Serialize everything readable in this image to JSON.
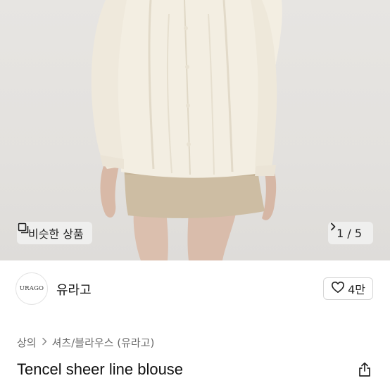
{
  "hero": {
    "similar_label": "비슷한 상품",
    "pager_label": "1 / 5",
    "icons": [
      "similar-items-icon",
      "chevron-right-icon"
    ]
  },
  "seller": {
    "logo_text": "URAGO",
    "name": "유라고",
    "likes_label": "4만",
    "icons": [
      "heart-icon"
    ]
  },
  "breadcrumb": {
    "level1": "상의",
    "level2": "셔츠/블라우스 (유라고)"
  },
  "product": {
    "title": "Tencel sheer line blouse",
    "icons": [
      "share-icon"
    ]
  }
}
